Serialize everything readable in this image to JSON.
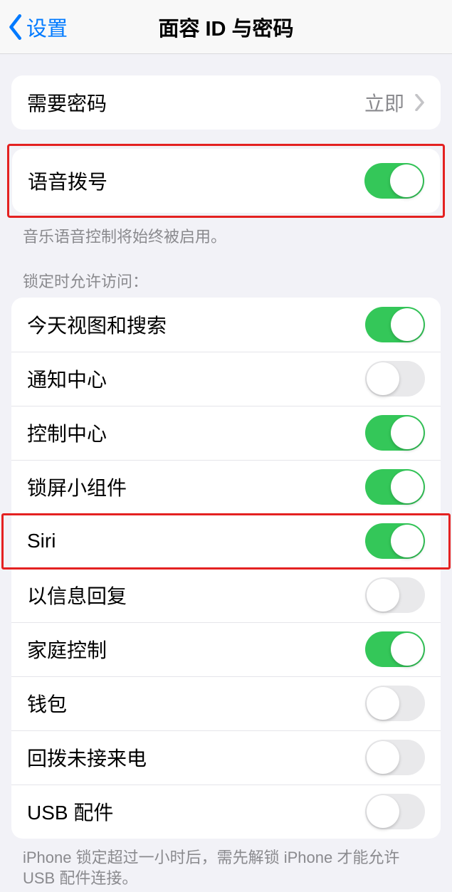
{
  "nav": {
    "back_label": "设置",
    "title": "面容 ID 与密码"
  },
  "require_passcode": {
    "label": "需要密码",
    "value": "立即"
  },
  "voice_dial": {
    "label": "语音拨号",
    "on": true,
    "footer": "音乐语音控制将始终被启用。"
  },
  "lock_access": {
    "header": "锁定时允许访问：",
    "items": [
      {
        "label": "今天视图和搜索",
        "on": true
      },
      {
        "label": "通知中心",
        "on": false
      },
      {
        "label": "控制中心",
        "on": true
      },
      {
        "label": "锁屏小组件",
        "on": true
      },
      {
        "label": "Siri",
        "on": true
      },
      {
        "label": "以信息回复",
        "on": false
      },
      {
        "label": "家庭控制",
        "on": true
      },
      {
        "label": "钱包",
        "on": false
      },
      {
        "label": "回拨未接来电",
        "on": false
      },
      {
        "label": "USB 配件",
        "on": false
      }
    ],
    "footer": "iPhone 锁定超过一小时后，需先解锁 iPhone 才能允许USB 配件连接。"
  }
}
